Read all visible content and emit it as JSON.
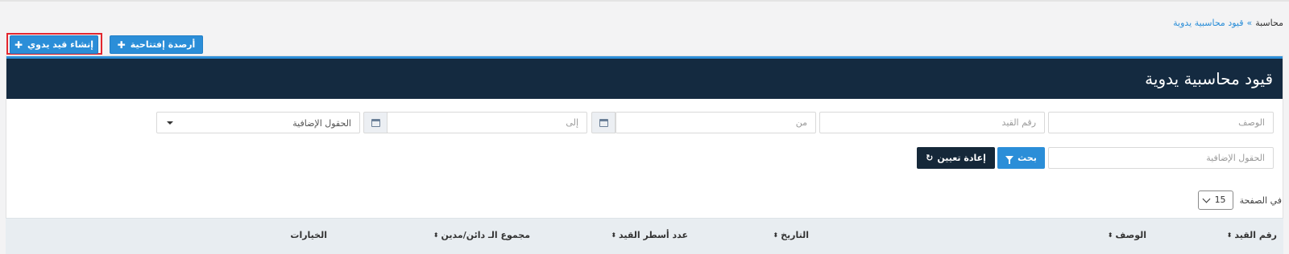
{
  "breadcrumb": {
    "root": "محاسبة",
    "separator": "»",
    "current": "قيود محاسبية يدوية"
  },
  "toolbar": {
    "create_manual_entry": "إنشاء قيد يدوي",
    "opening_balances": "أرصدة إفتتاحية"
  },
  "panel": {
    "title": "قيود محاسبية يدوية"
  },
  "filters": {
    "description_placeholder": "الوصف",
    "entry_number_placeholder": "رقم القيد",
    "from_placeholder": "من",
    "to_placeholder": "إلى",
    "extra_fields_select": "الحقول الإضافية",
    "extra_fields_input_placeholder": "الحقول الإضافية",
    "search_label": "بحث",
    "reset_label": "إعادة تعيين"
  },
  "pagination": {
    "per_page_label": "في الصفحة",
    "per_page_value": "15"
  },
  "table": {
    "columns": [
      "رقم القيد",
      "الوصف",
      "التاريخ",
      "عدد أسطر القيد",
      "مجموع الـ دائن/مدين",
      "الخيارات"
    ]
  },
  "colors": {
    "accent": "#2b8ed8",
    "header_dark": "#142a40",
    "highlight": "#e3262e"
  }
}
